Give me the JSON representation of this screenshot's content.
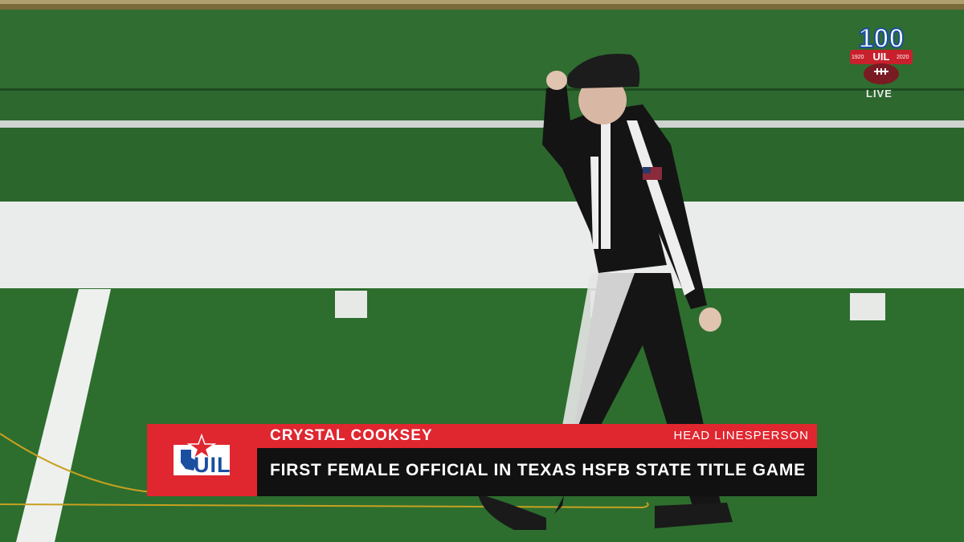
{
  "broadcast": {
    "corner_logo": {
      "number": "100",
      "org": "UIL",
      "year_left": "1920",
      "year_right": "2020",
      "live_label": "LIVE"
    },
    "lower_third": {
      "logo_text": "UIL",
      "name": "CRYSTAL COOKSEY",
      "role": "HEAD LINESPERSON",
      "headline": "FIRST FEMALE OFFICIAL IN TEXAS HSFB STATE TITLE GAME"
    }
  },
  "colors": {
    "lower_third_red": "#e0262f",
    "lower_third_dark": "#111111",
    "field_green": "#2d6a2e",
    "uil_blue": "#1a4fa0"
  }
}
